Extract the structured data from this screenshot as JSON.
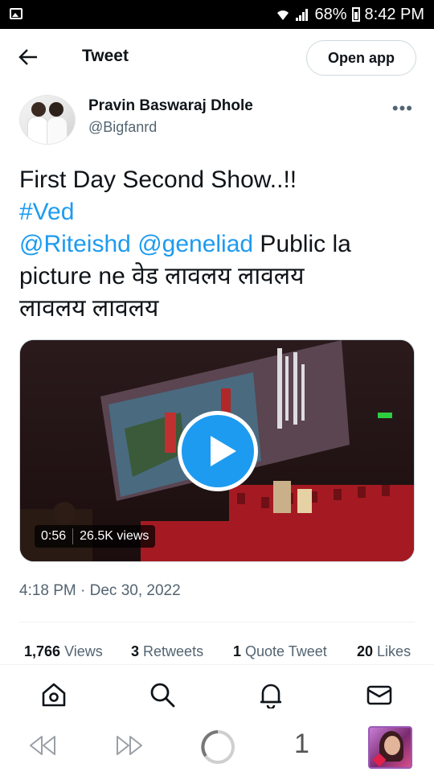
{
  "status_bar": {
    "battery": "68%",
    "time": "8:42 PM"
  },
  "header": {
    "title": "Tweet",
    "open_app_label": "Open app"
  },
  "author": {
    "name": "Pravin Baswaraj Dhole",
    "handle": "@Bigfanrd"
  },
  "tweet": {
    "line1": "First Day Second Show..!!",
    "hashtag": "#Ved",
    "mention1": "@Riteishd",
    "mention2": "@geneliad",
    "line3_rest": " Public la",
    "line4": "picture ne वेड लावलय लावलय",
    "line5": "लावलय लावलय"
  },
  "video": {
    "duration": "0:56",
    "views": "26.5K views"
  },
  "timestamp": "4:18 PM · Dec 30, 2022",
  "stats": [
    {
      "count": "1,766",
      "label": "Views"
    },
    {
      "count": "3",
      "label": "Retweets"
    },
    {
      "count": "1",
      "label": "Quote Tweet"
    },
    {
      "count": "20",
      "label": "Likes"
    }
  ],
  "bottom_nav": {
    "icons": [
      "home-icon",
      "search-icon",
      "notifications-icon",
      "messages-icon"
    ]
  },
  "browser_bar": {
    "tab_count": "1"
  }
}
